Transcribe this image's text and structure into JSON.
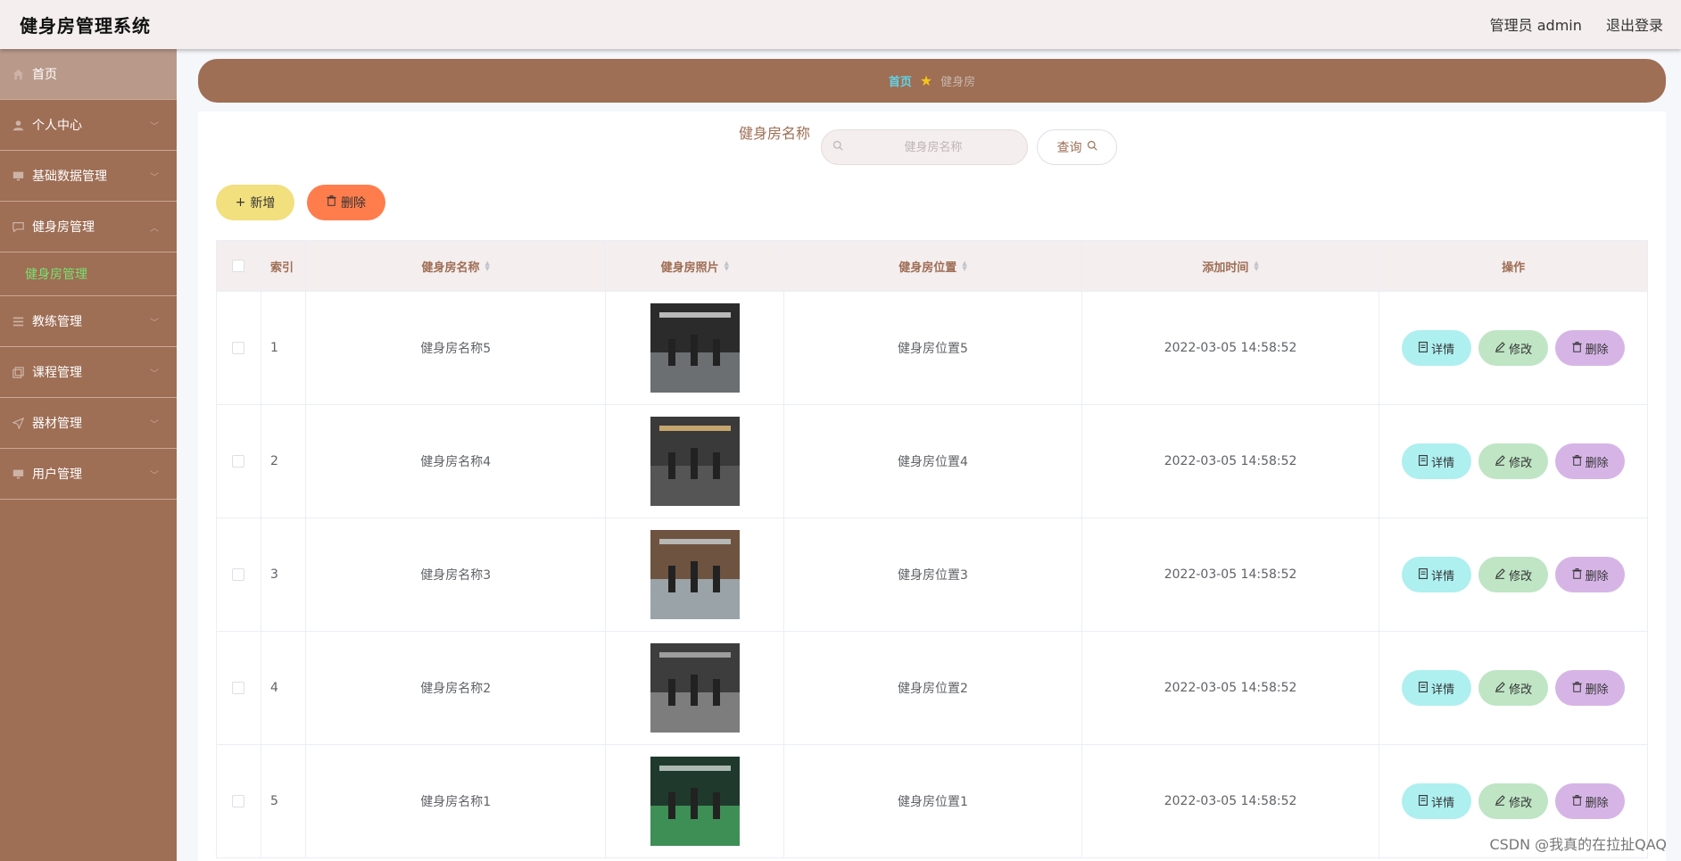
{
  "header": {
    "app_title": "健身房管理系统",
    "user_label": "管理员 admin",
    "logout_label": "退出登录"
  },
  "sidebar": {
    "items": [
      {
        "label": "首页",
        "icon": "home-icon",
        "active": true
      },
      {
        "label": "个人中心",
        "icon": "user-icon"
      },
      {
        "label": "基础数据管理",
        "icon": "monitor-icon"
      },
      {
        "label": "健身房管理",
        "icon": "chat-icon",
        "expanded": true
      },
      {
        "label": "教练管理",
        "icon": "list-icon"
      },
      {
        "label": "课程管理",
        "icon": "copy-icon"
      },
      {
        "label": "器材管理",
        "icon": "send-icon"
      },
      {
        "label": "用户管理",
        "icon": "monitor-icon"
      }
    ],
    "submenu_label": "健身房管理"
  },
  "breadcrumb": {
    "home": "首页",
    "current": "健身房"
  },
  "search": {
    "label": "健身房名称",
    "placeholder": "健身房名称",
    "query_label": "查询"
  },
  "toolbar": {
    "add_label": "新增",
    "delete_label": "删除"
  },
  "table": {
    "columns": [
      "索引",
      "健身房名称",
      "健身房照片",
      "健身房位置",
      "添加时间",
      "操作"
    ],
    "rows": [
      {
        "index": "1",
        "name": "健身房名称5",
        "location": "健身房位置5",
        "time": "2022-03-05 14:58:52"
      },
      {
        "index": "2",
        "name": "健身房名称4",
        "location": "健身房位置4",
        "time": "2022-03-05 14:58:52"
      },
      {
        "index": "3",
        "name": "健身房名称3",
        "location": "健身房位置3",
        "time": "2022-03-05 14:58:52"
      },
      {
        "index": "4",
        "name": "健身房名称2",
        "location": "健身房位置2",
        "time": "2022-03-05 14:58:52"
      },
      {
        "index": "5",
        "name": "健身房名称1",
        "location": "健身房位置1",
        "time": "2022-03-05 14:58:52"
      }
    ],
    "actions": {
      "detail": "详情",
      "edit": "修改",
      "delete": "删除"
    }
  },
  "watermark": "CSDN @我真的在拉扯QAQ",
  "colors": {
    "sidebar_bg": "#9e6e55",
    "accent_green": "#7ae06f",
    "detail_btn": "#aeeff0",
    "edit_btn": "#bfe5c5",
    "delete_btn": "#d6b5e6",
    "add_btn": "#f2df7e",
    "batch_delete_btn": "#ff7d4d"
  }
}
